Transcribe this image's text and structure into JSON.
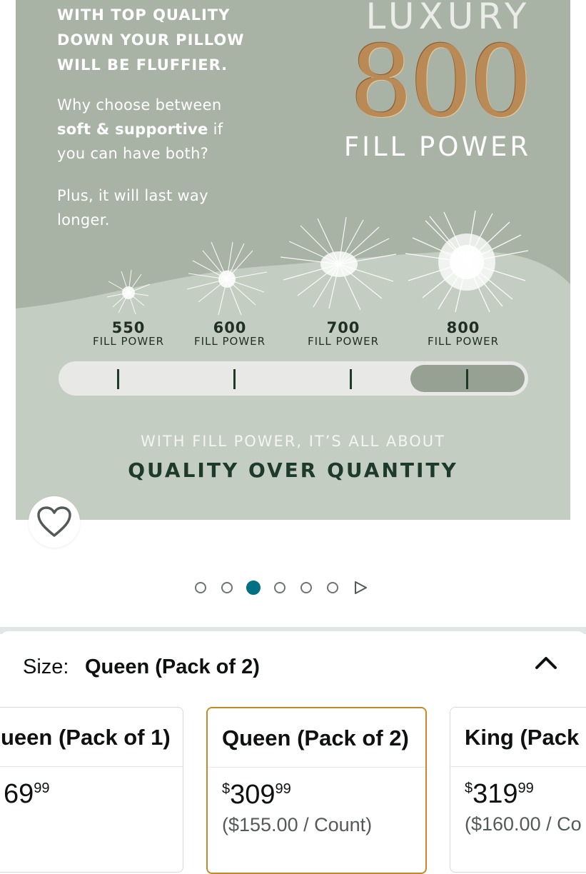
{
  "product_image": {
    "headline_lines": [
      "WITH TOP QUALITY",
      "DOWN YOUR PILLOW",
      "WILL BE FLUFFIER."
    ],
    "paragraph1": {
      "line1": "Why choose between",
      "line2_bold": "soft & supportive",
      "line2_rest": " if",
      "line3": "you can have both?"
    },
    "paragraph2_lines": [
      "Plus, it will last way",
      "longer."
    ],
    "luxury_word": "LUXURY",
    "luxury_number": "800",
    "luxury_sub": "FILL POWER",
    "fill_levels": [
      {
        "number": "550",
        "label": "FILL POWER"
      },
      {
        "number": "600",
        "label": "FILL POWER"
      },
      {
        "number": "700",
        "label": "FILL POWER"
      },
      {
        "number": "800",
        "label": "FILL POWER"
      }
    ],
    "tagline_top": "WITH FILL POWER, IT’S ALL ABOUT",
    "tagline_bottom": "QUALITY OVER QUANTITY",
    "colors": {
      "background": "#a8b3a5",
      "wave": "#c4cdc1",
      "gold": "#b98a55",
      "dark_green": "#1d3a2a"
    }
  },
  "wishlist": {
    "icon": "heart-outline-icon"
  },
  "carousel": {
    "count": 6,
    "active_index": 2,
    "next_icon": "play-triangle-icon",
    "active_color": "#007185"
  },
  "size_selector": {
    "label": "Size:",
    "selected_value": "Queen (Pack of 2)",
    "collapse_icon": "chevron-up-icon",
    "options": [
      {
        "name": "ueen (Pack of 1)",
        "price_currency": "",
        "price_whole": "69",
        "price_fraction": "99",
        "unit_price": ""
      },
      {
        "name": "Queen (Pack of 2)",
        "price_currency": "$",
        "price_whole": "309",
        "price_fraction": "99",
        "unit_price": "($155.00 / Count)"
      },
      {
        "name": "King (Pack",
        "price_currency": "$",
        "price_whole": "319",
        "price_fraction": "99",
        "unit_price": "($160.00 / Co"
      }
    ]
  }
}
